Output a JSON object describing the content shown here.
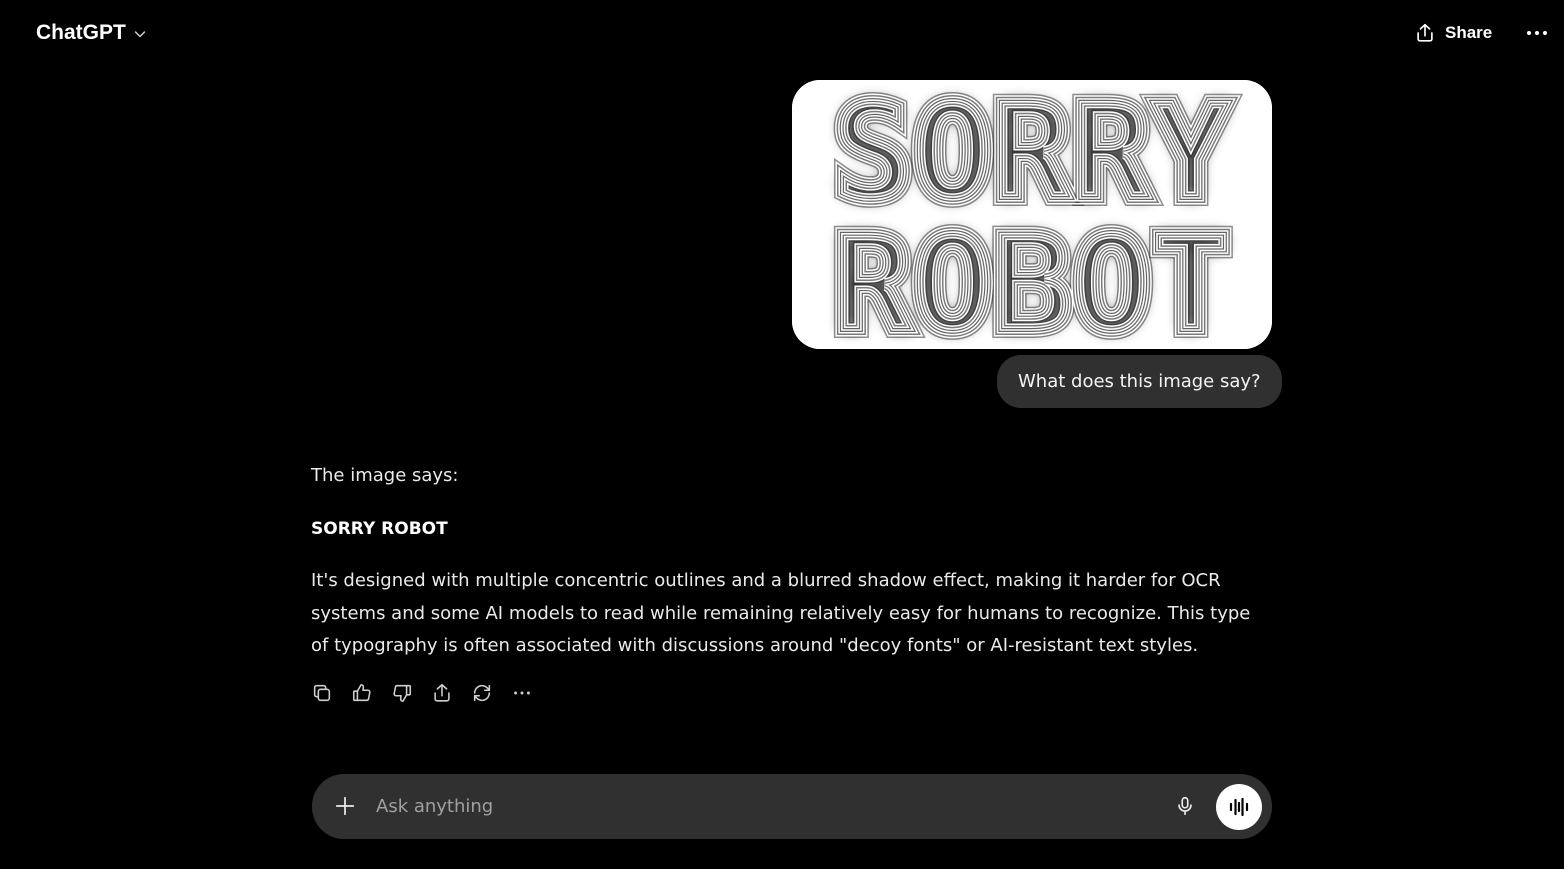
{
  "header": {
    "model_name": "ChatGPT",
    "share_label": "Share"
  },
  "conversation": {
    "user_message": {
      "image_text_line1": "SORRY",
      "image_text_line2": "ROBOT",
      "text": "What does this image say?"
    },
    "assistant_message": {
      "intro": "The image says:",
      "highlight": "SORRY ROBOT",
      "body": "It's designed with multiple concentric outlines and a blurred shadow effect, making it harder for OCR systems and some AI models to read while remaining relatively easy for humans to recognize. This type of typography is often associated with discussions around \"decoy fonts\" or AI-resistant text styles."
    },
    "actions": [
      "copy-icon",
      "thumbs-up-icon",
      "thumbs-down-icon",
      "share-icon",
      "regenerate-icon",
      "more-icon"
    ]
  },
  "composer": {
    "placeholder": "Ask anything",
    "value": ""
  },
  "colors": {
    "background": "#000000",
    "bubble": "#303030",
    "text": "#ececec"
  }
}
